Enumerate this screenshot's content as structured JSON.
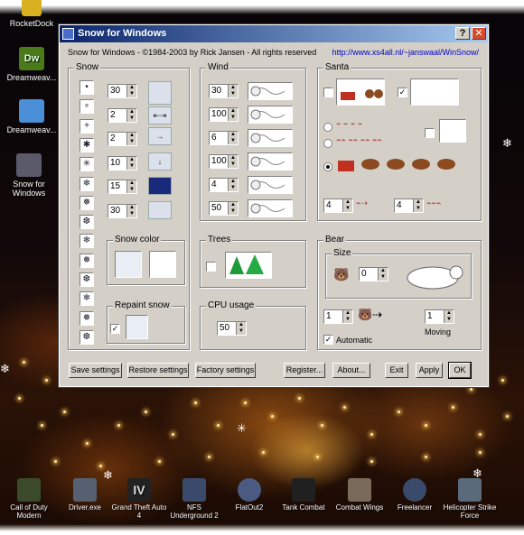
{
  "desktop_icons": [
    {
      "name": "rocketdock-icon",
      "label": "RocketDock",
      "color": "#d8b020"
    },
    {
      "name": "dreamweaver-icon",
      "label": "Dreamweav...",
      "color": "#4a7a1a"
    },
    {
      "name": "folder-icon",
      "label": "Dreamweav...",
      "color": "#4a8fd8"
    },
    {
      "name": "snow-for-windows-icon",
      "label": "Snow for Windows",
      "color": "#5a5a6a"
    }
  ],
  "taskbar_icons": [
    {
      "label": "Call of Duty Modern"
    },
    {
      "label": "Driver.exe"
    },
    {
      "label": "Grand Theft Auto 4"
    },
    {
      "label": "NFS Underground 2"
    },
    {
      "label": "FlatOut2"
    },
    {
      "label": "Tank Combat"
    },
    {
      "label": "Combat Wings"
    },
    {
      "label": "Freelancer"
    },
    {
      "label": "Helicopter Strike Force"
    }
  ],
  "window": {
    "title": "Snow for Windows",
    "help_label": "?",
    "close_label": "✕",
    "info": "Snow for Windows - ©1984-2003 by Rick Jansen - All rights reserved",
    "link": "http://www.xs4all.nl/~janswaal/WinSnow/"
  },
  "snow": {
    "title": "Snow",
    "flake_glyphs": [
      "•",
      "∘",
      "+",
      "✱",
      "✳",
      "❄",
      "❅",
      "❆",
      "❄",
      "❅",
      "❆",
      "❄",
      "❅",
      "❆"
    ],
    "spinners": [
      "30",
      "2",
      "2",
      "10",
      "15",
      "30"
    ],
    "snow_color_title": "Snow color",
    "repaint_title": "Repaint snow"
  },
  "wind": {
    "title": "Wind",
    "spinners": [
      "30",
      "100",
      "6",
      "100",
      "4",
      "50"
    ]
  },
  "santa": {
    "title": "Santa",
    "spin_left": "4",
    "spin_right": "4"
  },
  "trees": {
    "title": "Trees"
  },
  "cpu": {
    "title": "CPU usage",
    "value": "50"
  },
  "bear": {
    "title": "Bear",
    "size_title": "Size",
    "size_value": "0",
    "left_value": "1",
    "moving_value": "1",
    "moving_label": "Moving",
    "automatic_label": "Automatic"
  },
  "buttons": {
    "save": "Save settings",
    "restore": "Restore settings",
    "factory": "Factory settings",
    "register": "Register...",
    "about": "About...",
    "exit": "Exit",
    "apply": "Apply",
    "ok": "OK"
  }
}
